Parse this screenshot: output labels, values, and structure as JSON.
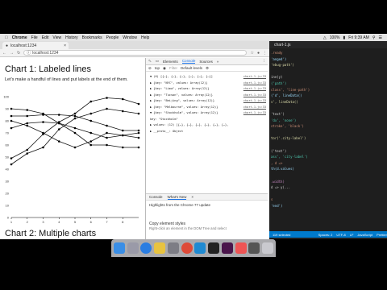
{
  "menubar": {
    "items": [
      "Chrome",
      "File",
      "Edit",
      "View",
      "History",
      "Bookmarks",
      "People",
      "Window",
      "Help"
    ],
    "battery": "100%",
    "clock": "Fri 9:39 AM"
  },
  "browser": {
    "tab_title": "localhost:1234",
    "url": "localhost:1234"
  },
  "page": {
    "title": "Chart 1: Labeled lines",
    "paragraph": "Let's make a handful of lines and put labels at the end of them.",
    "next_heading": "Chart 2: Multiple charts"
  },
  "chart_data": {
    "type": "line",
    "x": [
      1,
      2,
      3,
      4,
      5,
      6,
      7,
      8,
      9
    ],
    "x_tick_labels": [
      "1",
      "2",
      "3",
      "4",
      "5",
      "6",
      "7",
      "8"
    ],
    "ylim": [
      0,
      100
    ],
    "y_ticks": [
      "0",
      "10",
      "20",
      "30",
      "40",
      "50",
      "60",
      "70",
      "80",
      "90",
      "100"
    ],
    "series": [
      {
        "values": [
          49,
          56,
          69,
          79,
          86,
          96,
          99,
          98,
          94
        ]
      },
      {
        "values": [
          44,
          53,
          58,
          73,
          82,
          86,
          90,
          88,
          86
        ]
      },
      {
        "values": [
          84,
          84,
          85,
          85,
          84,
          80,
          76,
          72,
          72
        ]
      },
      {
        "values": [
          74,
          78,
          79,
          78,
          74,
          70,
          66,
          68,
          70
        ]
      },
      {
        "values": [
          90,
          89,
          86,
          78,
          70,
          60,
          60,
          58,
          58
        ]
      },
      {
        "values": [
          80,
          76,
          70,
          63,
          58,
          63,
          70,
          68,
          66
        ]
      }
    ]
  },
  "devtools": {
    "tabs": [
      "Elements",
      "Console",
      "Sources"
    ],
    "active_tab": "Console",
    "context": "top",
    "filter_placeholder": "Filter",
    "level": "Default levels",
    "log": [
      {
        "text": "▼ (6) [{…}, {…}, {…}, {…}, {…}, {…}]",
        "src": "chart-1.js:33"
      },
      {
        "text": "  ▶ {key: \"NYC\", values: Array(12)}",
        "src": "chart-1.js:33"
      },
      {
        "text": "  ▶ {key: \"Lima\", values: Array(12)}",
        "src": "chart-1.js:33"
      },
      {
        "text": "  ▶ {key: \"Tucson\", values: Array(12)}",
        "src": "chart-1.js:33"
      },
      {
        "text": "  ▶ {key: \"Beijing\", values: Array(12)}",
        "src": "chart-1.js:33"
      },
      {
        "text": "  ▶ {key: \"Melbourne\", values: Array(12)}",
        "src": "chart-1.js:33"
      },
      {
        "text": "  ▼ {key: \"Stockholm\", values: Array(12)}",
        "src": "chart-1.js:33"
      },
      {
        "text": "      key: \"Stockholm\"",
        "src": ""
      },
      {
        "text": "    ▶ values: (12) [{…}, {…}, {…}, {…}, {…}, {…},",
        "src": ""
      },
      {
        "text": "    ▶ __proto__: Object",
        "src": ""
      }
    ],
    "drawer_tabs": [
      "Console",
      "What's New"
    ],
    "drawer_headline": "Highlights from the Chrome 77 update",
    "drawer_item_title": "Copy element styles",
    "drawer_item_sub": "Right-click an element in the DOM Tree and select"
  },
  "editor": {
    "tab": "chart-1.js",
    "lines": [
      ".ready",
      "'anged')",
      "  'ebug-path')",
      "",
      "ine(y)",
      "  ('path')",
      "  class', 'line-path')",
      "  ('d', lineData()",
      "  s', lineData()",
      "",
      "  'text')",
      "  'dx', 'none')",
      "  stroke', 'black')",
      "",
      "  tor('.city-label')",
      "",
      "  ('text')",
      "  ass', 'city-label')",
      "  , d => ",
      "  th(d.values)",
      "",
      "  .width)",
      "  d => y(...",
      "",
      "  s",
      "  'end')"
    ],
    "status": [
      "119 selected",
      "Spaces: 2",
      "UTF-8",
      "LF",
      "JavaScript",
      "Prettier"
    ]
  },
  "colors": {
    "editor_bg": "#1e1e1e",
    "statusbar": "#007acc",
    "chrome_accent": "#1a73e8"
  }
}
